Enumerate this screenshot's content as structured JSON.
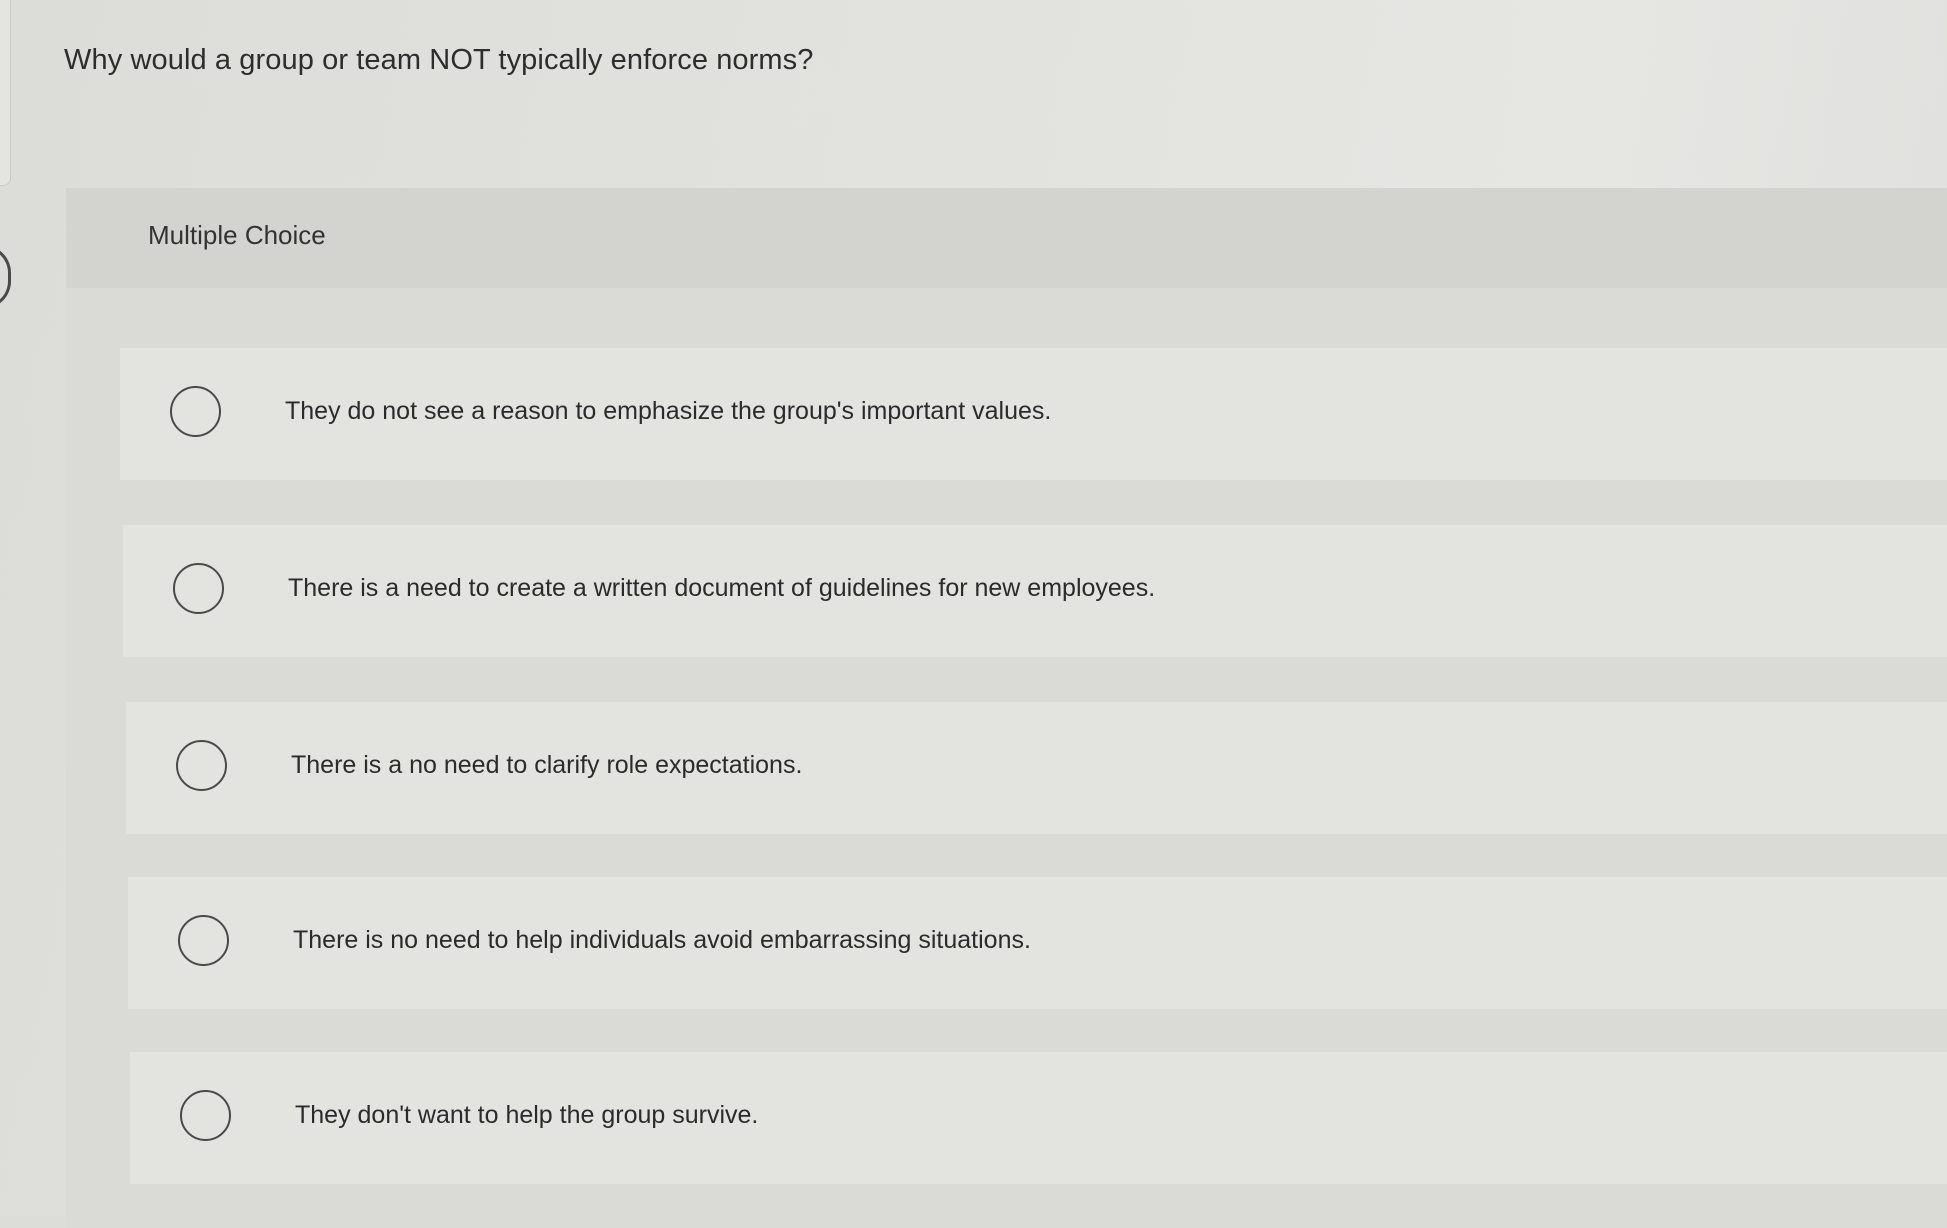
{
  "question": {
    "text": "Why would a group or team NOT typically enforce norms?"
  },
  "multiple_choice": {
    "label": "Multiple Choice",
    "options": [
      {
        "text": "They do not see a reason to emphasize the group's important values."
      },
      {
        "text": "There is a need to create a written document of guidelines for new employees."
      },
      {
        "text": "There is a no need to clarify role expectations."
      },
      {
        "text": "There is no need to help individuals avoid embarrassing situations."
      },
      {
        "text": "They don't want to help the group survive."
      }
    ]
  }
}
